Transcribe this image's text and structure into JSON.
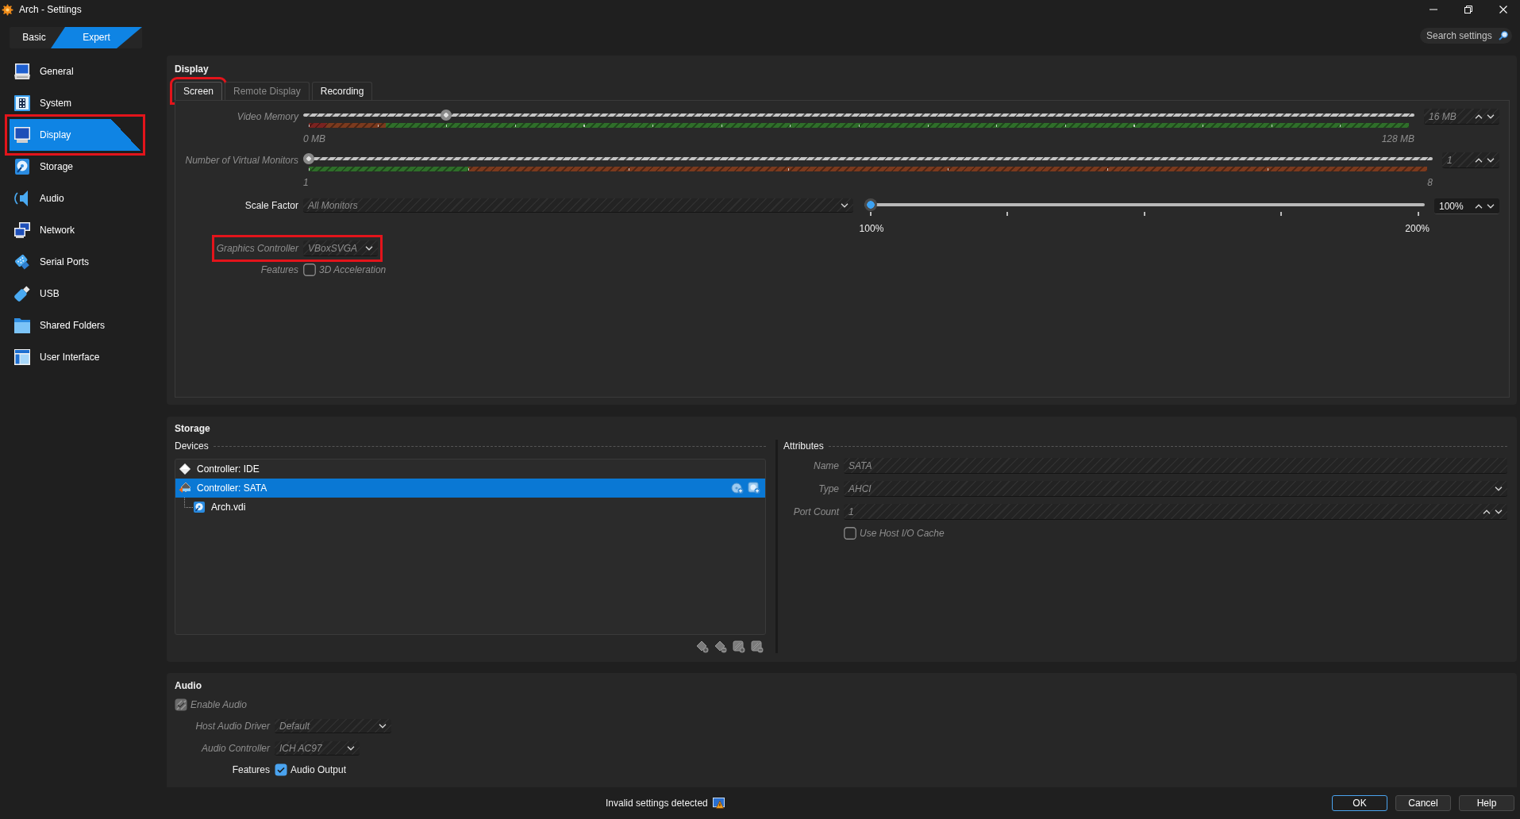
{
  "window": {
    "title": "Arch - Settings"
  },
  "mode_switch": [
    {
      "label": "Basic",
      "selected": false
    },
    {
      "label": "Expert",
      "selected": true
    }
  ],
  "search": {
    "placeholder": "Search settings"
  },
  "sidebar": {
    "items": [
      {
        "label": "General",
        "selected": false,
        "highlighted": false
      },
      {
        "label": "System",
        "selected": false,
        "highlighted": false
      },
      {
        "label": "Display",
        "selected": true,
        "highlighted": true
      },
      {
        "label": "Storage",
        "selected": false,
        "highlighted": false
      },
      {
        "label": "Audio",
        "selected": false,
        "highlighted": false
      },
      {
        "label": "Network",
        "selected": false,
        "highlighted": false
      },
      {
        "label": "Serial Ports",
        "selected": false,
        "highlighted": false
      },
      {
        "label": "USB",
        "selected": false,
        "highlighted": false
      },
      {
        "label": "Shared Folders",
        "selected": false,
        "highlighted": false
      },
      {
        "label": "User Interface",
        "selected": false,
        "highlighted": false
      }
    ]
  },
  "display": {
    "heading": "Display",
    "tabs": [
      {
        "label": "Screen",
        "selected": true,
        "highlighted": true,
        "disabled": false
      },
      {
        "label": "Remote Display",
        "selected": false,
        "highlighted": false,
        "disabled": true
      },
      {
        "label": "Recording",
        "selected": false,
        "highlighted": false,
        "disabled": false
      }
    ],
    "video_memory": {
      "label": "Video Memory",
      "disabled": true,
      "level": 0.125,
      "min_label": "0 MB",
      "max_label": "128 MB",
      "value": "16 MB"
    },
    "virtual_monitors": {
      "label": "Number of Virtual Monitors",
      "disabled": true,
      "level": 0,
      "min_label": "1",
      "max_label": "8",
      "value": "1"
    },
    "scale_factor": {
      "label": "Scale Factor",
      "disabled": false,
      "monitor": {
        "value": "All Monitors",
        "disabled": true
      },
      "level": 0,
      "min_label": "100%",
      "max_label": "200%",
      "value": "100%"
    },
    "graphics_controller": {
      "label": "Graphics Controller",
      "value": "VBoxSVGA",
      "disabled": true,
      "highlighted": true
    },
    "features": {
      "label": "Features",
      "option": "3D Acceleration",
      "checked": false,
      "disabled": true
    }
  },
  "storage": {
    "heading": "Storage",
    "devices": {
      "label": "Devices",
      "tree": [
        {
          "label": "Controller: IDE",
          "kind": "ide",
          "selected": false
        },
        {
          "label": "Controller: SATA",
          "kind": "sata",
          "selected": true,
          "children": [
            {
              "label": "Arch.vdi",
              "kind": "disk",
              "selected": false
            }
          ]
        }
      ]
    },
    "attributes": {
      "label": "Attributes",
      "disabled": true,
      "name": {
        "label": "Name",
        "value": "SATA"
      },
      "type": {
        "label": "Type",
        "value": "AHCI"
      },
      "port_count": {
        "label": "Port Count",
        "value": "1"
      },
      "host_io_cache": {
        "label": "Use Host I/O Cache",
        "checked": false
      }
    }
  },
  "audio": {
    "heading": "Audio",
    "enable_audio": {
      "label": "Enable Audio",
      "checked": true,
      "disabled": true
    },
    "host_audio_driver": {
      "label": "Host Audio Driver",
      "value": "Default",
      "disabled": true
    },
    "audio_controller": {
      "label": "Audio Controller",
      "value": "ICH AC97",
      "disabled": true
    },
    "features": {
      "label": "Features",
      "option": "Audio Output",
      "checked": true,
      "disabled": false
    }
  },
  "status_bar": {
    "message": "Invalid settings detected"
  },
  "buttons": [
    {
      "label": "OK",
      "default": true
    },
    {
      "label": "Cancel",
      "default": false
    },
    {
      "label": "Help",
      "default": false
    }
  ]
}
